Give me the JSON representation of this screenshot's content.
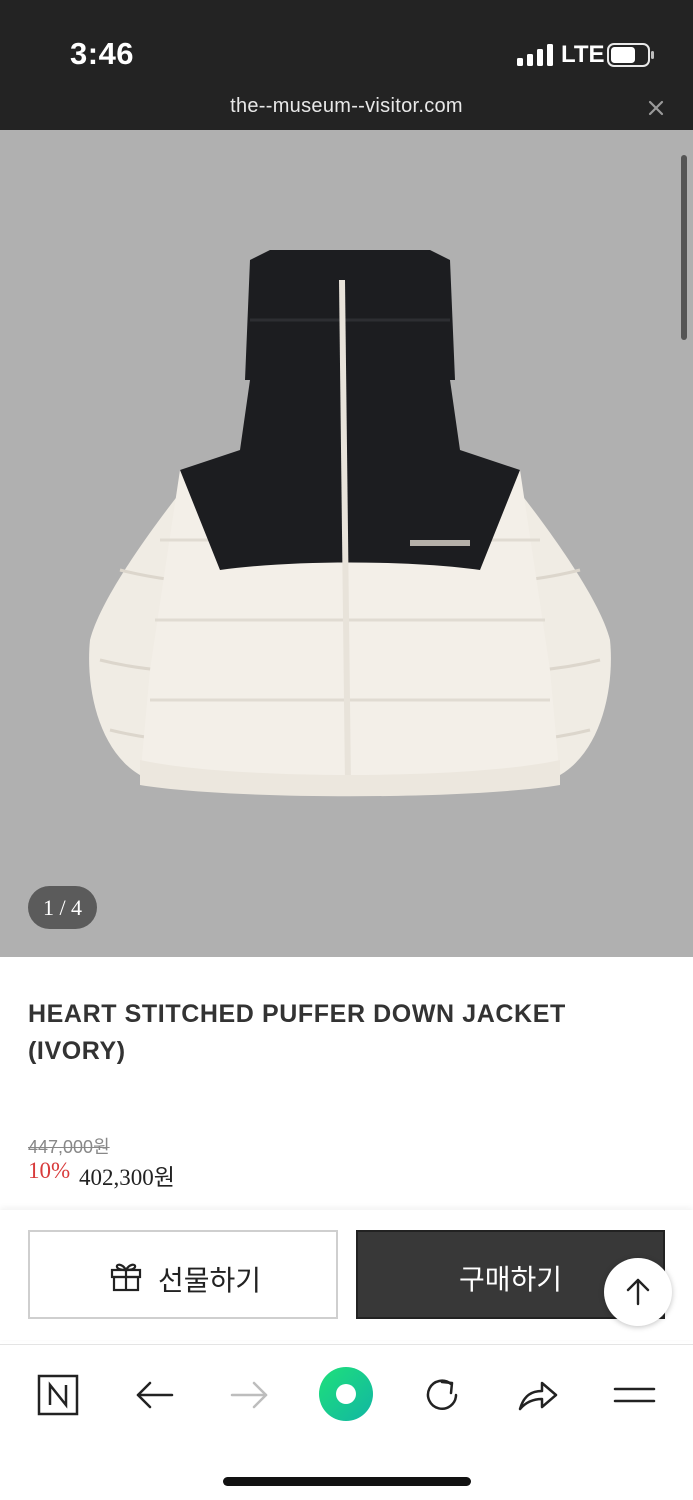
{
  "status_bar": {
    "time": "3:46",
    "network": "LTE",
    "icons": [
      "signal-icon",
      "battery-icon"
    ]
  },
  "url_bar": {
    "url": "the--museum--visitor.com",
    "icons": [
      "close-icon"
    ]
  },
  "gallery": {
    "counter": "1 / 4",
    "image": "puffer-jacket-photo"
  },
  "product": {
    "title": "HEART STITCHED PUFFER DOWN JACKET (IVORY)",
    "original_price": "447,000원",
    "discount": "10%",
    "price": "402,300원"
  },
  "actions": {
    "gift_label": "선물하기",
    "buy_label": "구매하기",
    "icons": [
      "gift-icon",
      "arrow-up-icon"
    ]
  },
  "browser_toolbar": {
    "icons": [
      "naver-n-icon",
      "back-arrow-icon",
      "forward-arrow-icon",
      "green-dot-icon",
      "reload-icon",
      "share-icon",
      "menu-icon"
    ]
  },
  "colors": {
    "status_bar": "#232323",
    "hero_bg": "#b0b0b0",
    "discount": "#d83b3b",
    "buy_button": "#383838",
    "green_dot": "#17c964"
  }
}
